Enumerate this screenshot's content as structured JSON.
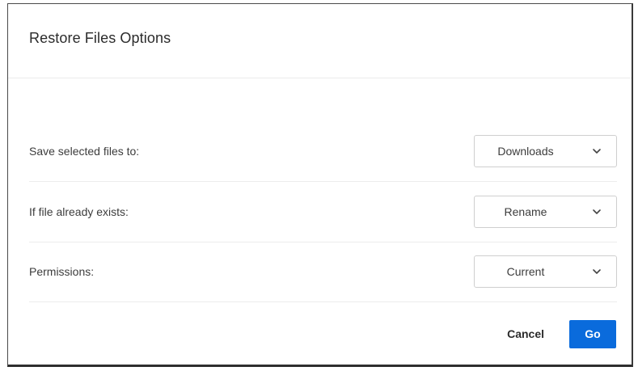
{
  "dialog": {
    "title": "Restore Files Options"
  },
  "rows": [
    {
      "label": "Save selected files to:",
      "value": "Downloads",
      "icon": "chevron-down-icon"
    },
    {
      "label": "If file already exists:",
      "value": "Rename",
      "icon": "chevron-down-icon"
    },
    {
      "label": "Permissions:",
      "value": "Current",
      "icon": "chevron-down-icon"
    }
  ],
  "footer": {
    "cancel_label": "Cancel",
    "go_label": "Go"
  },
  "colors": {
    "accent": "#0a6bdc",
    "divider": "#ececec",
    "text": "#3c3c3c"
  }
}
